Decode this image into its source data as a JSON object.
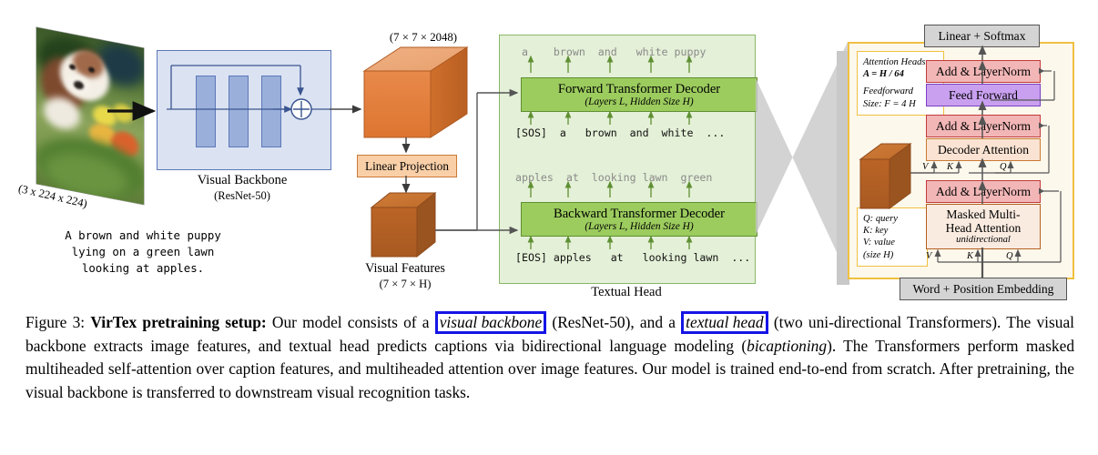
{
  "figure": {
    "input_image": {
      "dim_label": "(3 x 224 x 224)",
      "caption_line1": "A brown and white puppy",
      "caption_line2": "lying on a green lawn",
      "caption_line3": "looking at apples."
    },
    "visual_backbone": {
      "title": "Visual Backbone",
      "subtitle": "(ResNet-50)"
    },
    "features": {
      "cube_top_label": "(7 × 7 × 2048)",
      "linear_projection": "Linear Projection",
      "visual_features_title": "Visual Features",
      "visual_features_dim": "(7 × 7 × H)"
    },
    "textual_head": {
      "label": "Textual Head",
      "forward_decoder": {
        "title": "Forward Transformer Decoder",
        "subtitle": "(Layers L, Hidden Size H)"
      },
      "backward_decoder": {
        "title": "Backward Transformer Decoder",
        "subtitle": "(Layers L, Hidden Size H)"
      },
      "forward_outputs": [
        "a",
        "brown",
        "and",
        "white",
        "puppy"
      ],
      "forward_inputs": [
        "[SOS]",
        "a",
        "brown",
        "and",
        "white",
        "..."
      ],
      "backward_outputs": [
        "apples",
        "at",
        "looking",
        "lawn",
        "green"
      ],
      "backward_inputs": [
        "[EOS]",
        "apples",
        "at",
        "looking",
        "lawn",
        "..."
      ],
      "forward_output_line": "a    brown  and   white puppy",
      "forward_input_line": "[SOS]  a   brown  and  white  ...",
      "backward_output_line": "apples  at  looking lawn  green",
      "backward_input_line": "[EOS] apples   at   looking lawn  ..."
    },
    "detail_panel": {
      "linear_softmax": "Linear + Softmax",
      "add_layernorm_top": "Add & LayerNorm",
      "feed_forward": "Feed Forward",
      "add_layernorm_mid": "Add & LayerNorm",
      "decoder_attention": "Decoder Attention",
      "add_layernorm_bottom": "Add & LayerNorm",
      "masked_attention_line1": "Masked Multi-",
      "masked_attention_line2": "Head Attention",
      "masked_attention_sub": "unidirectional",
      "word_position_embedding": "Word + Position Embedding",
      "note_heads_line1": "Attention Heads:",
      "note_heads_line2": "A = H / 64",
      "note_heads_line3": "Feedforward",
      "note_heads_line4": "Size: F = 4 H",
      "note_qkv_line1": "Q: query",
      "note_qkv_line2": "K: key",
      "note_qkv_line3": "V: value",
      "note_qkv_line4": "(size H)",
      "v_label": "V",
      "k_label": "K",
      "q_label": "Q"
    },
    "colors": {
      "decoder_green": "#9ccc5e",
      "textual_head_green": "#e4f0d7",
      "cube_orange": "#e07b39",
      "backbone_blue": "#dbe2f2",
      "panel_yellow": "#f0c040",
      "highlight_blue": "#1414e6",
      "feed_forward_purple": "#c9a0f0",
      "layernorm_red": "#f2b6b6"
    }
  },
  "caption": {
    "figure_number": "Figure 3:",
    "bold_title": "VirTex pretraining setup:",
    "text_part1": " Our model consists of a ",
    "highlight1": "visual backbone",
    "text_part2": " (ResNet-50), and a ",
    "highlight2": "textual head",
    "text_part3": " (two uni-directional Transformers).  The visual backbone extracts image features, and textual head predicts captions via bidirectional language modeling (",
    "italic1": "bicaptioning",
    "text_part4": ").  The Transformers perform masked multiheaded self-attention over caption features, and multiheaded attention over image features.  Our model is trained end-to-end from scratch.  After pretraining, the visual backbone is transferred to downstream visual recognition tasks."
  }
}
